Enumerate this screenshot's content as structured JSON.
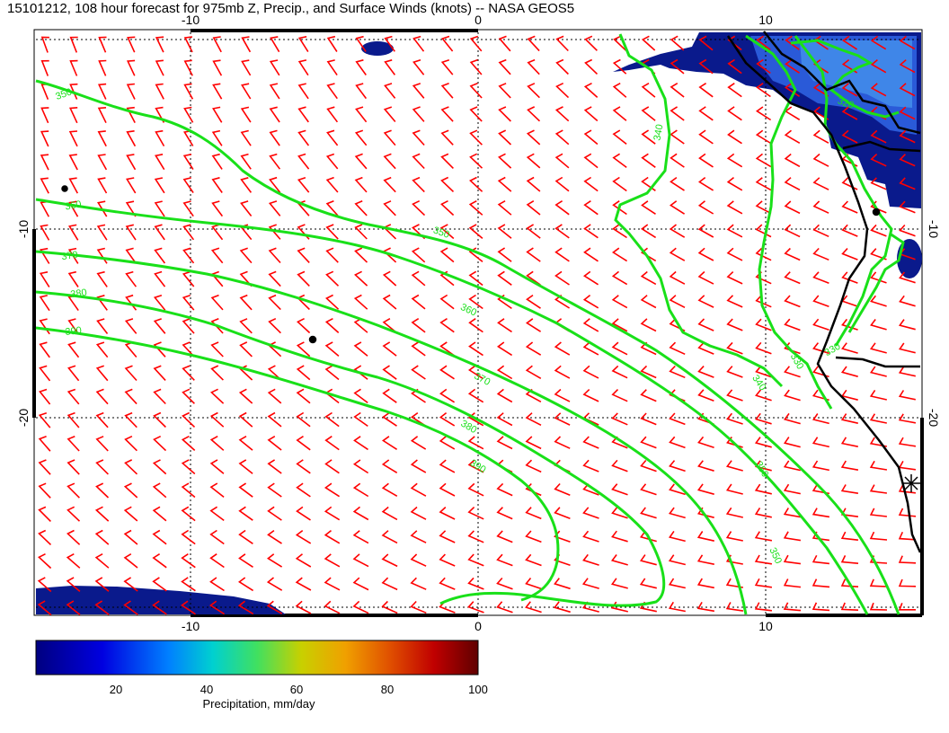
{
  "title": "15101212, 108 hour forecast for 975mb Z, Precip., and Surface Winds (knots) -- NASA GEOS5",
  "axes": {
    "lon_ticks": [
      -10,
      0,
      10
    ],
    "lat_ticks": [
      -10,
      -20
    ],
    "lon_range": [
      -15.5,
      15.5
    ],
    "lat_range": [
      -30.5,
      -2.5
    ]
  },
  "contours": {
    "color": "#19e019",
    "labels": [
      "350",
      "360",
      "370",
      "380",
      "390",
      "350",
      "360",
      "370",
      "380",
      "390",
      "340",
      "340",
      "350",
      "350",
      "330",
      "330",
      "320"
    ]
  },
  "colorbar": {
    "label": "Precipitation, mm/day",
    "ticks": [
      "20",
      "40",
      "60",
      "80",
      "100"
    ],
    "range": [
      0,
      100
    ]
  },
  "colors": {
    "wind_barbs": "#ff0000",
    "coastline": "#000000",
    "precip_low": "#0a1a8c",
    "precip_mid": "#2a5ad8"
  },
  "legend_icon": "storm-asterisk-icon"
}
